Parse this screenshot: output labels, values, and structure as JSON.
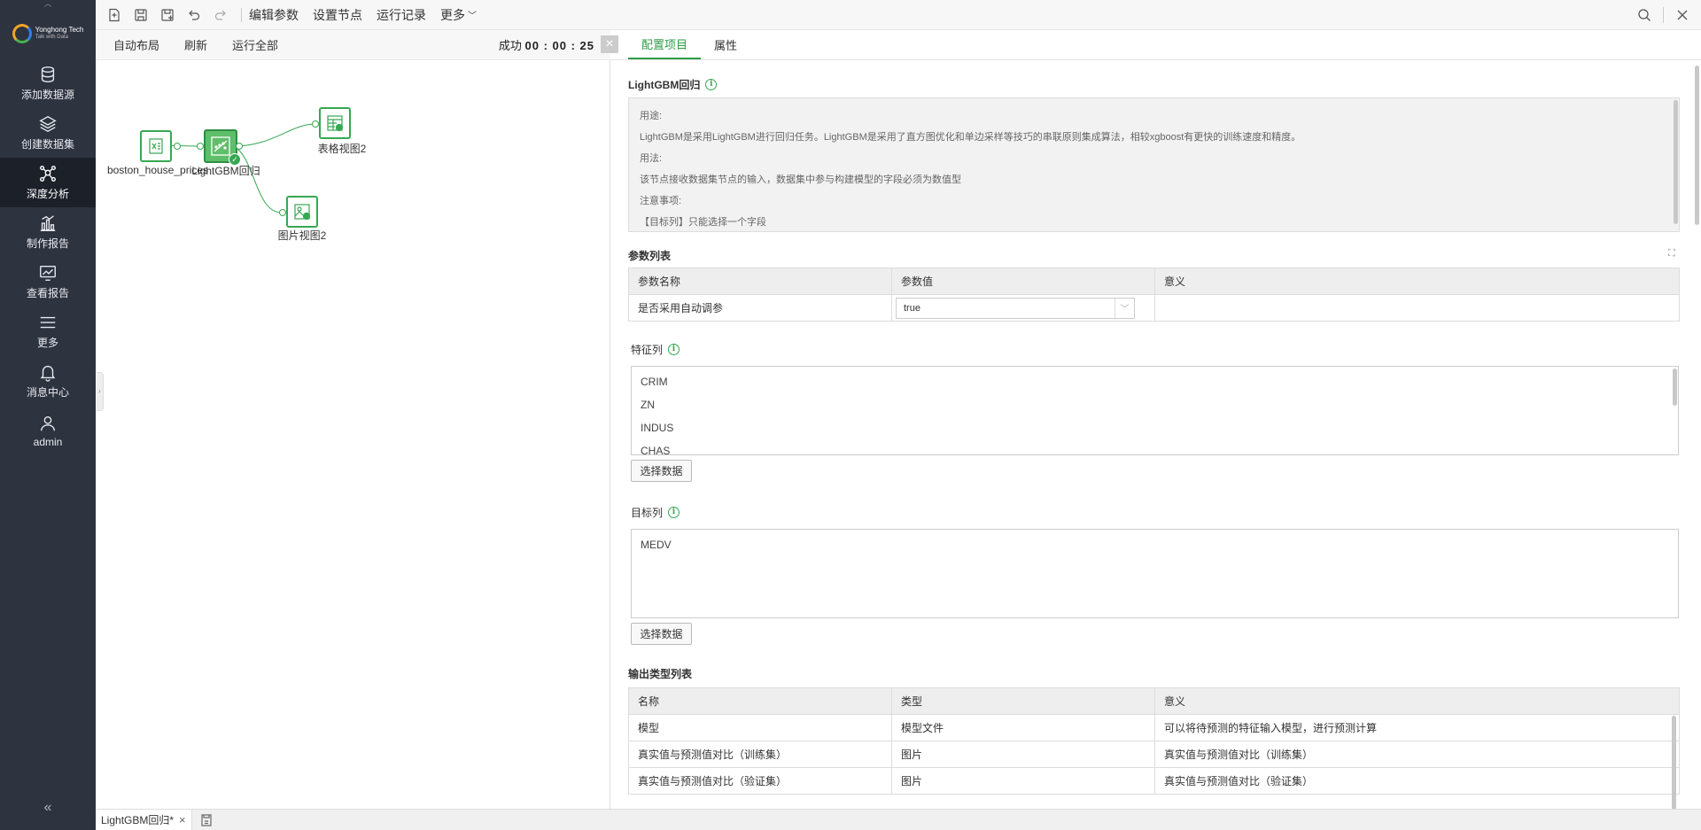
{
  "sidebar": {
    "logo": {
      "brand": "Yonghong Tech",
      "tagline": "Talk with Data"
    },
    "items": [
      {
        "label": "添加数据源",
        "icon": "database-icon"
      },
      {
        "label": "创建数据集",
        "icon": "layers-icon"
      },
      {
        "label": "深度分析",
        "icon": "network-icon",
        "active": true
      },
      {
        "label": "制作报告",
        "icon": "bar-chart-icon"
      },
      {
        "label": "查看报告",
        "icon": "line-chart-icon"
      },
      {
        "label": "更多",
        "icon": "menu-icon"
      },
      {
        "label": "消息中心",
        "icon": "bell-icon"
      },
      {
        "label": "admin",
        "icon": "user-icon"
      }
    ]
  },
  "toolbar": {
    "edit_params": "编辑参数",
    "set_node": "设置节点",
    "run_log": "运行记录",
    "more": "更多"
  },
  "canvas": {
    "auto_layout": "自动布局",
    "refresh": "刷新",
    "run_all": "运行全部",
    "status_label": "成功",
    "status_time": "00 : 00 : 25",
    "nodes": {
      "source": "boston_house_prices",
      "model": "LightGBM回归",
      "table_view": "表格视图2",
      "image_view": "图片视图2"
    }
  },
  "tabs": {
    "config": "配置项目",
    "props": "属性"
  },
  "panel": {
    "title": "LightGBM回归",
    "description": [
      "用途:",
      "LightGBM是采用LightGBM进行回归任务。LightGBM是采用了直方图优化和单边采样等技巧的串联原则集成算法，相较xgboost有更快的训练速度和精度。",
      "用法:",
      "该节点接收数据集节点的输入，数据集中参与构建模型的字段必须为数值型",
      "注意事项:",
      "【目标列】只能选择一个字段"
    ],
    "params": {
      "title": "参数列表",
      "headers": [
        "参数名称",
        "参数值",
        "意义"
      ],
      "rows": [
        {
          "name": "是否采用自动调参",
          "value": "true",
          "meaning": ""
        }
      ]
    },
    "features": {
      "title": "特征列",
      "items": [
        "CRIM",
        "ZN",
        "INDUS",
        "CHAS"
      ],
      "button": "选择数据"
    },
    "target": {
      "title": "目标列",
      "items": [
        "MEDV"
      ],
      "button": "选择数据"
    },
    "outputs": {
      "title": "输出类型列表",
      "headers": [
        "名称",
        "类型",
        "意义"
      ],
      "rows": [
        {
          "name": "模型",
          "type": "模型文件",
          "meaning": "可以将待预测的特征输入模型，进行预测计算"
        },
        {
          "name": "真实值与预测值对比（训练集）",
          "type": "图片",
          "meaning": "真实值与预测值对比（训练集）"
        },
        {
          "name": "真实值与预测值对比（验证集）",
          "type": "图片",
          "meaning": "真实值与预测值对比（验证集）"
        }
      ]
    }
  },
  "bottom": {
    "doc_tab": "LightGBM回归*"
  },
  "colors": {
    "accent": "#2e9c48",
    "sidebar": "#2e3340"
  }
}
